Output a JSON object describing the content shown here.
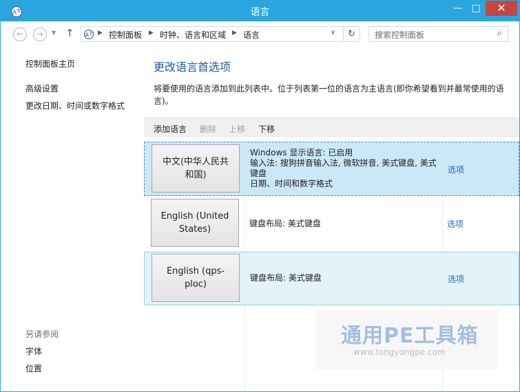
{
  "window": {
    "title": "语言",
    "minimize": "—",
    "maximize": "□",
    "close": "✕"
  },
  "nav": {
    "breadcrumbs": [
      "控制面板",
      "时钟、语言和区域",
      "语言"
    ],
    "search_placeholder": "搜索控制面板",
    "back": "←",
    "forward": "→",
    "up": "↑",
    "refresh": "↻",
    "dropdown": "∨"
  },
  "left": {
    "home": "控制面板主页",
    "advanced": "高级设置",
    "datetime": "更改日期、时间或数字格式",
    "see_also": "另请参阅",
    "fonts": "字体",
    "location": "位置"
  },
  "main": {
    "title": "更改语言首选项",
    "description": "将要使用的语言添加到此列表中。位于列表第一位的语言为主语言(即你希望看到并最常使用的语言)。"
  },
  "toolbar": {
    "add": "添加语言",
    "remove": "删除",
    "move_up": "上移",
    "move_down": "下移"
  },
  "languages": [
    {
      "name": "中文(中华人民共和国)",
      "info": [
        "Windows 显示语言: 已启用",
        "输入法: 搜狗拼音输入法, 微软拼音, 美式键盘, 美式键盘",
        "日期、时间和数字格式"
      ],
      "options": "选项",
      "state": "selected"
    },
    {
      "name": "English (United States)",
      "info": [
        "键盘布局: 美式键盘"
      ],
      "options": "选项",
      "state": "normal"
    },
    {
      "name": "English (qps-ploc)",
      "info": [
        "键盘布局: 美式键盘"
      ],
      "options": "选项",
      "state": "hover"
    }
  ],
  "watermark": {
    "title": "通用PE工具箱",
    "url": "www.tongyongpe.com"
  },
  "colors": {
    "titlebar": "#2aa5e0",
    "close": "#c7463f",
    "link": "#1c6bbd",
    "heading": "#1c5ba8",
    "selected_row": "#cbe8f6"
  }
}
